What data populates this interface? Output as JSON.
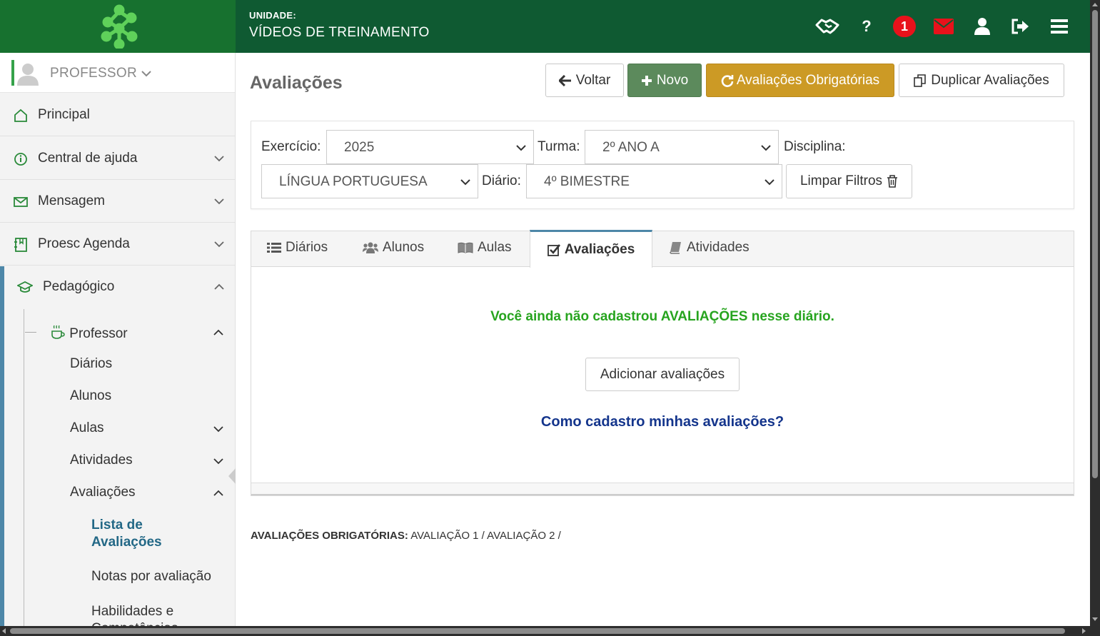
{
  "header": {
    "unit_label": "UNIDADE:",
    "unit_name": "VÍDEOS DE TREINAMENTO",
    "notification_count": "1",
    "icons": [
      "handshake-icon",
      "help-icon",
      "notification-badge",
      "mail-icon",
      "user-icon",
      "logout-icon",
      "menu-icon"
    ],
    "colors": {
      "header_bg": "#0f5a32",
      "logo_bg": "#17712f",
      "badge": "#e8121b",
      "mail": "#e8121b"
    }
  },
  "sidebar": {
    "profile": "PROFESSOR",
    "items": [
      {
        "label": "Principal",
        "icon": "home-icon"
      },
      {
        "label": "Central de ajuda",
        "icon": "info-icon"
      },
      {
        "label": "Mensagem",
        "icon": "envelope-icon"
      },
      {
        "label": "Proesc Agenda",
        "icon": "agenda-icon"
      },
      {
        "label": "Pedagógico",
        "icon": "graduation-cap-icon"
      }
    ],
    "professor": {
      "label": "Professor",
      "icon": "coffee-cup-icon"
    },
    "professor_items": [
      "Diários",
      "Alunos",
      "Aulas",
      "Atividades",
      "Avaliações"
    ],
    "avaliacoes_items": [
      "Lista de Avaliações",
      "Notas por avaliação",
      "Habilidades e Competências"
    ],
    "active_line1": "Lista de",
    "active_line2": "Avaliações"
  },
  "main": {
    "title": "Avaliações",
    "buttons": {
      "back": "Voltar",
      "new": "Novo",
      "mandatory": "Avaliações Obrigatórias",
      "duplicate": "Duplicar Avaliações"
    },
    "filters": {
      "exercicio_label": "Exercício:",
      "exercicio_value": "2025",
      "turma_label": "Turma:",
      "turma_value": "2º ANO A",
      "disciplina_label": "Disciplina:",
      "disciplina_value": "LÍNGUA PORTUGUESA",
      "diario_label": "Diário:",
      "diario_value": "4º BIMESTRE",
      "clear_button": "Limpar Filtros"
    },
    "tabs": [
      {
        "label": "Diários",
        "icon": "list-icon"
      },
      {
        "label": "Alunos",
        "icon": "users-icon"
      },
      {
        "label": "Aulas",
        "icon": "book-open-icon"
      },
      {
        "label": "Avaliações",
        "icon": "check-square-icon",
        "active": true
      },
      {
        "label": "Atividades",
        "icon": "book-icon"
      }
    ],
    "empty_message": "Você ainda não cadastrou AVALIAÇÕES nesse diário.",
    "add_button": "Adicionar avaliações",
    "help_link": "Como cadastro minhas avaliações?",
    "mandatory_label": "AVALIAÇÕES OBRIGATÓRIAS:",
    "mandatory_value": "AVALIAÇÃO 1 / AVALIAÇÃO 2 /"
  }
}
